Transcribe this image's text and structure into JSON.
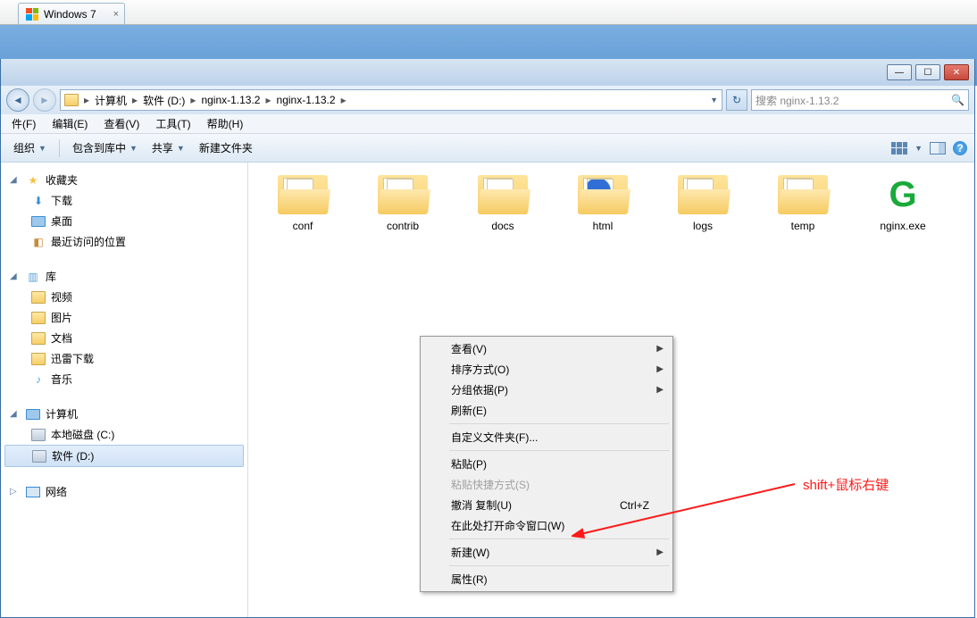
{
  "vm_tab": {
    "title": "Windows 7",
    "close": "×"
  },
  "window_controls": {
    "min": "—",
    "max": "☐",
    "close": "✕"
  },
  "breadcrumb": {
    "segments": [
      "计算机",
      "软件 (D:)",
      "nginx-1.13.2",
      "nginx-1.13.2"
    ]
  },
  "search": {
    "placeholder": "搜索 nginx-1.13.2"
  },
  "menubar": {
    "items": [
      "件(F)",
      "编辑(E)",
      "查看(V)",
      "工具(T)",
      "帮助(H)"
    ]
  },
  "toolbar": {
    "organize": "组织",
    "include": "包含到库中",
    "share": "共享",
    "newfolder": "新建文件夹"
  },
  "sidebar": {
    "favorites": "收藏夹",
    "downloads": "下载",
    "desktop": "桌面",
    "recent": "最近访问的位置",
    "library": "库",
    "video": "视频",
    "pictures": "图片",
    "documents": "文档",
    "thunder": "迅雷下载",
    "music": "音乐",
    "computer": "计算机",
    "diskC": "本地磁盘 (C:)",
    "diskD": "软件 (D:)",
    "network": "网络"
  },
  "files": [
    {
      "name": "conf",
      "type": "folder"
    },
    {
      "name": "contrib",
      "type": "folder"
    },
    {
      "name": "docs",
      "type": "folder"
    },
    {
      "name": "html",
      "type": "folder-html"
    },
    {
      "name": "logs",
      "type": "folder"
    },
    {
      "name": "temp",
      "type": "folder"
    },
    {
      "name": "nginx.exe",
      "type": "exe"
    }
  ],
  "context_menu": {
    "view": "查看(V)",
    "sort": "排序方式(O)",
    "group": "分组依据(P)",
    "refresh": "刷新(E)",
    "customize": "自定义文件夹(F)...",
    "paste": "粘贴(P)",
    "paste_shortcut": "粘贴快捷方式(S)",
    "undo": "撤消 复制(U)",
    "undo_key": "Ctrl+Z",
    "cmd_here": "在此处打开命令窗口(W)",
    "new": "新建(W)",
    "props": "属性(R)"
  },
  "annotation": "shift+鼠标右键"
}
